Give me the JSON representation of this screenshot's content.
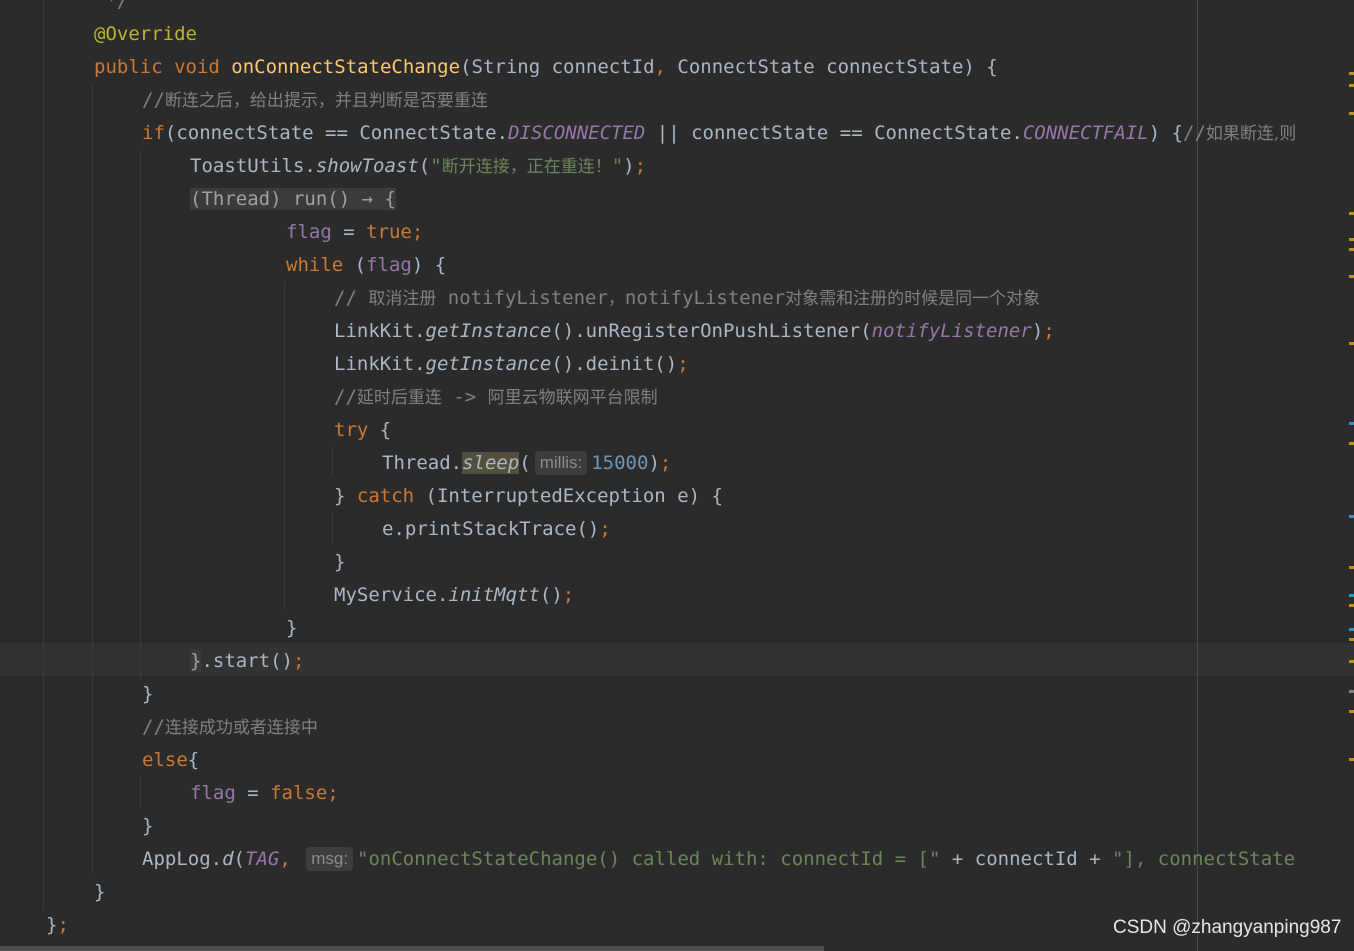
{
  "editor": {
    "lines": [
      {
        "segs": [
          [
            "cm",
            " */"
          ]
        ]
      },
      {
        "segs": [
          [
            "ann",
            "@Override"
          ]
        ]
      },
      {
        "segs": [
          [
            "k",
            "public void "
          ],
          [
            "fn",
            "onConnectStateChange"
          ],
          [
            "",
            "(String connectId"
          ],
          [
            "k",
            ", "
          ],
          [
            "",
            "ConnectState connectState) {"
          ]
        ]
      },
      {
        "segs": [
          [
            "cm",
            "//"
          ],
          [
            "cm cjk",
            "断连之后，给出提示，并且判断是否要重连"
          ]
        ]
      },
      {
        "segs": [
          [
            "k",
            "if"
          ],
          [
            "",
            "(connectState == ConnectState."
          ],
          [
            "sf",
            "DISCONNECTED"
          ],
          [
            "",
            " || connectState == ConnectState."
          ],
          [
            "sf",
            "CONNECTFAIL"
          ],
          [
            "",
            ") {"
          ],
          [
            "cm",
            "//"
          ],
          [
            "cm cjk",
            "如果断连,则"
          ]
        ]
      },
      {
        "segs": [
          [
            "",
            "ToastUtils."
          ],
          [
            "it",
            "showToast"
          ],
          [
            "",
            "("
          ],
          [
            "str",
            "\""
          ],
          [
            "str cjk",
            "断开连接，正在重连！"
          ],
          [
            "str",
            "\""
          ],
          [
            "",
            ")"
          ],
          [
            "k",
            ";"
          ]
        ]
      },
      {
        "segs": [
          [
            "lambda",
            "(Thread) run() → {"
          ]
        ]
      },
      {
        "segs": [
          [
            "fld",
            "flag"
          ],
          [
            "",
            " = "
          ],
          [
            "k",
            "true;"
          ]
        ]
      },
      {
        "segs": [
          [
            "k",
            "while "
          ],
          [
            "",
            "("
          ],
          [
            "fld",
            "flag"
          ],
          [
            "",
            ") {"
          ]
        ]
      },
      {
        "segs": [
          [
            "cm",
            "// "
          ],
          [
            "cm cjk",
            "取消注册"
          ],
          [
            "cm",
            " notifyListener"
          ],
          [
            "cm cjk",
            "，"
          ],
          [
            "cm",
            "notifyListener"
          ],
          [
            "cm cjk",
            "对象需和注册的时候是同一个对象"
          ]
        ]
      },
      {
        "segs": [
          [
            "",
            "LinkKit."
          ],
          [
            "it",
            "getInstance"
          ],
          [
            "",
            "().unRegisterOnPushListener("
          ],
          [
            "sf",
            "notifyListener"
          ],
          [
            "",
            ")"
          ],
          [
            "k",
            ";"
          ]
        ]
      },
      {
        "segs": [
          [
            "",
            "LinkKit."
          ],
          [
            "it",
            "getInstance"
          ],
          [
            "",
            "().deinit()"
          ],
          [
            "k",
            ";"
          ]
        ]
      },
      {
        "segs": [
          [
            "cm",
            "//"
          ],
          [
            "cm cjk",
            "延时后重连"
          ],
          [
            "cm",
            " -> "
          ],
          [
            "cm cjk",
            "阿里云物联网平台限制"
          ]
        ]
      },
      {
        "segs": [
          [
            "k",
            "try "
          ],
          [
            "",
            "{"
          ]
        ]
      },
      {
        "segs": [
          [
            "",
            "Thread."
          ],
          [
            "it hl",
            "sleep"
          ],
          [
            "",
            "("
          ],
          [
            "hint",
            "millis:"
          ],
          [
            "num",
            "15000"
          ],
          [
            "",
            ")"
          ],
          [
            "k",
            ";"
          ]
        ]
      },
      {
        "segs": [
          [
            "",
            "} "
          ],
          [
            "k",
            "catch "
          ],
          [
            "",
            "(InterruptedException e) {"
          ]
        ]
      },
      {
        "segs": [
          [
            "",
            "e.printStackTrace()"
          ],
          [
            "k",
            ";"
          ]
        ]
      },
      {
        "segs": [
          [
            "",
            "}"
          ]
        ]
      },
      {
        "segs": [
          [
            "",
            "MyService."
          ],
          [
            "it",
            "initMqtt"
          ],
          [
            "",
            "()"
          ],
          [
            "k",
            ";"
          ]
        ]
      },
      {
        "segs": [
          [
            "",
            "}"
          ]
        ]
      },
      {
        "segs": [
          [
            "lambda",
            "}"
          ],
          [
            "",
            ".start()"
          ],
          [
            "k",
            ";"
          ]
        ]
      },
      {
        "segs": [
          [
            "",
            "}"
          ]
        ]
      },
      {
        "segs": [
          [
            "cm",
            "//"
          ],
          [
            "cm cjk",
            "连接成功或者连接中"
          ]
        ]
      },
      {
        "segs": [
          [
            "k",
            "else"
          ],
          [
            "",
            "{"
          ]
        ]
      },
      {
        "segs": [
          [
            "fld",
            "flag"
          ],
          [
            "",
            " = "
          ],
          [
            "k",
            "false;"
          ]
        ]
      },
      {
        "segs": [
          [
            "",
            "}"
          ]
        ]
      },
      {
        "segs": [
          [
            "",
            "AppLog."
          ],
          [
            "it",
            "d"
          ],
          [
            "",
            "("
          ],
          [
            "sf",
            "TAG"
          ],
          [
            "k",
            ", "
          ],
          [
            "hint",
            "msg:"
          ],
          [
            "str",
            "\"onConnectStateChange() called with: connectId = [\""
          ],
          [
            "",
            " + connectId + "
          ],
          [
            "str",
            "\"], connectState"
          ]
        ]
      },
      {
        "segs": [
          [
            "",
            "}"
          ]
        ]
      },
      {
        "segs": [
          [
            "",
            "}"
          ],
          [
            "k",
            ";"
          ]
        ]
      }
    ]
  },
  "marker_colors": {
    "warning": "#be9117",
    "info": "#3592c4",
    "neutral": "#808080"
  },
  "watermark": "CSDN @zhangyanping987"
}
